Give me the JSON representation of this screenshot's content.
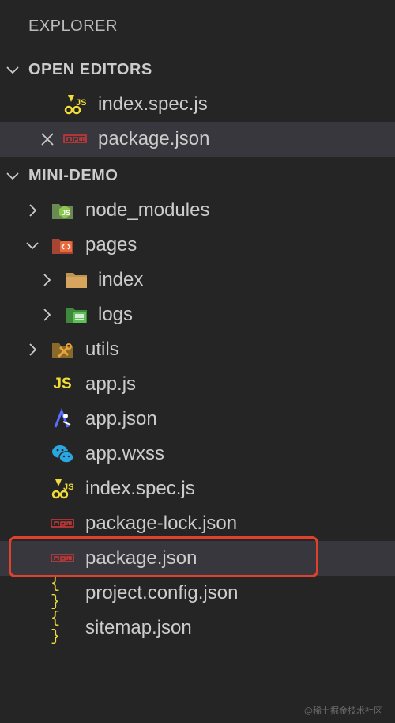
{
  "explorer": {
    "title": "EXPLORER"
  },
  "open_editors": {
    "label": "OPEN EDITORS",
    "items": [
      {
        "label": "index.spec.js",
        "icon": "jest-icon"
      },
      {
        "label": "package.json",
        "icon": "npm-icon"
      }
    ]
  },
  "project": {
    "label": "MINI-DEMO",
    "items": [
      {
        "label": "node_modules",
        "icon": "node-folder-icon"
      },
      {
        "label": "pages",
        "icon": "pages-folder-icon"
      },
      {
        "label": "index",
        "icon": "folder-icon"
      },
      {
        "label": "logs",
        "icon": "logs-folder-icon"
      },
      {
        "label": "utils",
        "icon": "utils-folder-icon"
      },
      {
        "label": "app.js",
        "icon": "js-icon",
        "glyph": "JS"
      },
      {
        "label": "app.json",
        "icon": "app-json-icon"
      },
      {
        "label": "app.wxss",
        "icon": "wechat-icon"
      },
      {
        "label": "index.spec.js",
        "icon": "jest-icon"
      },
      {
        "label": "package-lock.json",
        "icon": "npm-icon"
      },
      {
        "label": "package.json",
        "icon": "npm-icon"
      },
      {
        "label": "project.config.json",
        "icon": "json-braces-icon",
        "glyph": "{ }"
      },
      {
        "label": "sitemap.json",
        "icon": "json-braces-icon",
        "glyph": "{ }"
      }
    ]
  },
  "watermark": "@稀土掘金技术社区",
  "colors": {
    "background": "#252526",
    "selected": "#37373d",
    "highlight": "#e0412d",
    "js": "#f1dd35",
    "npm": "#cb3837"
  }
}
